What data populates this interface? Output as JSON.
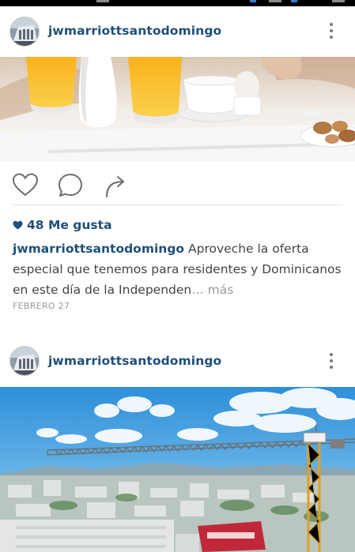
{
  "posts": [
    {
      "username": "jwmarriottsantodomingo",
      "likes": "48 Me gusta",
      "caption_user": "jwmarriottsantodomingo",
      "caption_text": "Aproveche la oferta especial que tenemos para residentes y Dominicanos en este día de la Independen",
      "caption_more": "… más",
      "date": "FEBRERO 27",
      "photo": "breakfast-orange-juice-photo"
    },
    {
      "username": "jwmarriottsantodomingo",
      "photo": "city-skyline-crane-photo"
    }
  ],
  "icons": {
    "like": "heart-outline-icon",
    "comment": "comment-bubble-icon",
    "share": "share-arrow-icon",
    "more": "three-dots-vertical-icon",
    "likes_marker": "heart-filled-icon"
  },
  "colors": {
    "username": "#1f4f7a",
    "caption_text": "#444444",
    "muted": "#9a9a9a",
    "icon": "#7a7a7a"
  }
}
